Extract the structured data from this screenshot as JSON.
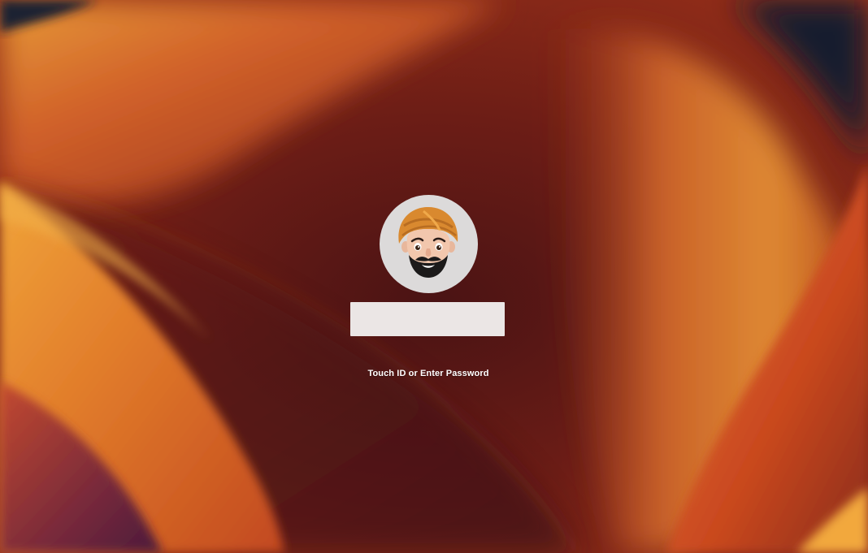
{
  "lock_screen": {
    "user": {
      "avatar_icon": "memoji-avatar-icon"
    },
    "password": {
      "value": "",
      "placeholder": ""
    },
    "hint": "Touch ID or Enter Password"
  },
  "colors": {
    "wallpaper_dark": "#2a0d12",
    "wallpaper_red": "#8e2818",
    "wallpaper_orange": "#e07a28",
    "wallpaper_amber": "#f0a33a",
    "field_background": "#ebe6e5",
    "avatar_background": "#dcdada"
  }
}
